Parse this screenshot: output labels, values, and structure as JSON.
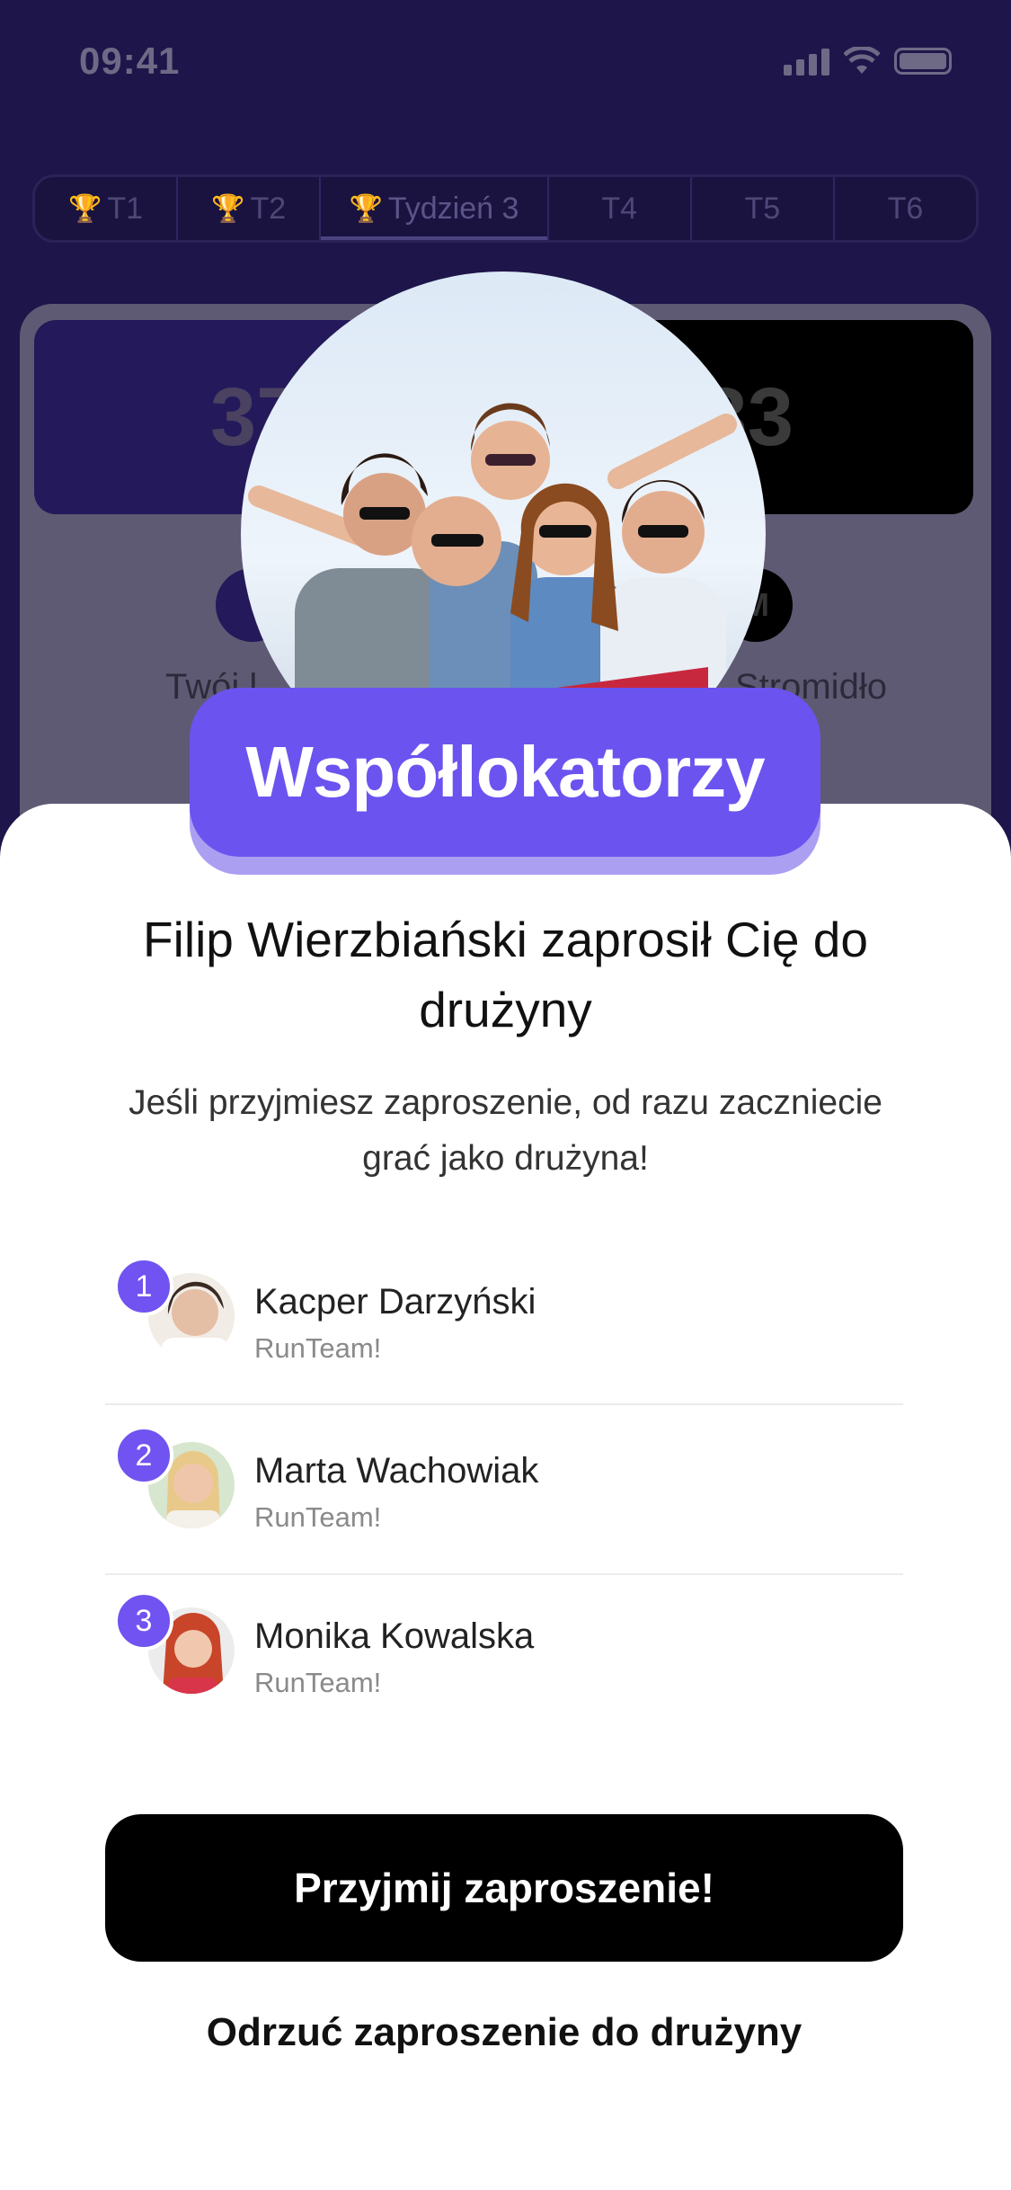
{
  "status": {
    "time": "09:41"
  },
  "tabs": [
    {
      "label": "T1",
      "trophy": true
    },
    {
      "label": "T2",
      "trophy": true
    },
    {
      "label": "Tydzień 3",
      "trophy": true,
      "selected": true
    },
    {
      "label": "T4",
      "trophy": false
    },
    {
      "label": "T5",
      "trophy": false
    },
    {
      "label": "T6",
      "trophy": false
    }
  ],
  "background": {
    "score_left": "37",
    "score_right": "33",
    "avatar_right": "M",
    "name_left": "Twój l",
    "name_right": "Stromidło"
  },
  "modal": {
    "team_name": "Współlokatorzy",
    "title": "Filip Wierzbiański zaprosił Cię do drużyny",
    "subtitle": "Jeśli przyjmiesz zaproszenie, od razu zaczniecie grać jako drużyna!",
    "members": [
      {
        "rank": "1",
        "name": "Kacper Darzyński",
        "team": "RunTeam!"
      },
      {
        "rank": "2",
        "name": "Marta Wachowiak",
        "team": "RunTeam!"
      },
      {
        "rank": "3",
        "name": "Monika Kowalska",
        "team": "RunTeam!"
      }
    ],
    "accept_label": "Przyjmij zaproszenie!",
    "reject_label": "Odrzuć zaproszenie do drużyny"
  },
  "colors": {
    "accent": "#6b53f0",
    "background": "#1e164a"
  }
}
